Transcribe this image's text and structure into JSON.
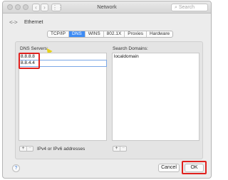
{
  "window": {
    "title": "Network",
    "search_placeholder": "Search"
  },
  "toolbar": {
    "back_icon": "chevron-left",
    "forward_icon": "chevron-right",
    "grid_icon": "grid"
  },
  "service": {
    "name": "Ethernet",
    "icon": "ethernet-arrows-icon"
  },
  "tabs": [
    {
      "label": "TCP/IP",
      "active": false
    },
    {
      "label": "DNS",
      "active": true
    },
    {
      "label": "WINS",
      "active": false
    },
    {
      "label": "802.1X",
      "active": false
    },
    {
      "label": "Proxies",
      "active": false
    },
    {
      "label": "Hardware",
      "active": false
    }
  ],
  "dns": {
    "servers_label": "DNS Servers:",
    "servers": [
      "8.8.8.8",
      "8.8.4.4"
    ],
    "hint": "IPv4 or IPv6 addresses"
  },
  "search_domains": {
    "label": "Search Domains:",
    "domains": [
      "localdomain"
    ]
  },
  "controls": {
    "add": "+",
    "remove": "−"
  },
  "footer": {
    "help": "?",
    "cancel": "Cancel",
    "ok": "OK"
  },
  "colors": {
    "accent": "#3e8cf5",
    "highlight": "#e0211e"
  }
}
